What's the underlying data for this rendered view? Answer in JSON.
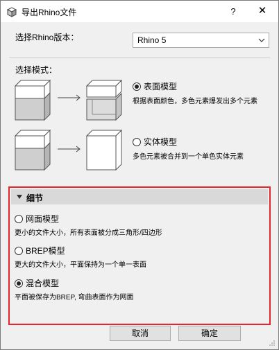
{
  "window": {
    "title": "导出Rhino文件",
    "help_glyph": "?",
    "close_glyph": "✕"
  },
  "version": {
    "label": "选择Rhino版本：",
    "selected": "Rhino 5"
  },
  "mode": {
    "label": "选择模式：",
    "options": [
      {
        "label": "表面模型",
        "desc": "根据表面颜色，多色元素爆发出多个元素",
        "checked": true
      },
      {
        "label": "实体模型",
        "desc": "多色元素被合并到一个单色实体元素",
        "checked": false
      }
    ]
  },
  "details": {
    "title": "细节",
    "highlight_color": "#e8262a",
    "options": [
      {
        "label": "网面模型",
        "desc": "更小的文件大小，所有表面被分成三角形/四边形",
        "checked": false
      },
      {
        "label": "BREP模型",
        "desc": "更大的文件大小，平面保持为一个单一表面",
        "checked": false
      },
      {
        "label": "混合模型",
        "desc": "平面被保存为BREP, 弯曲表面作为网面",
        "checked": true
      }
    ]
  },
  "buttons": {
    "cancel": "取消",
    "ok": "确定"
  },
  "icons": {
    "app": "rhino-cube-icon",
    "select_arrow": "chevron-down-icon",
    "collapse": "triangle-down-icon"
  }
}
